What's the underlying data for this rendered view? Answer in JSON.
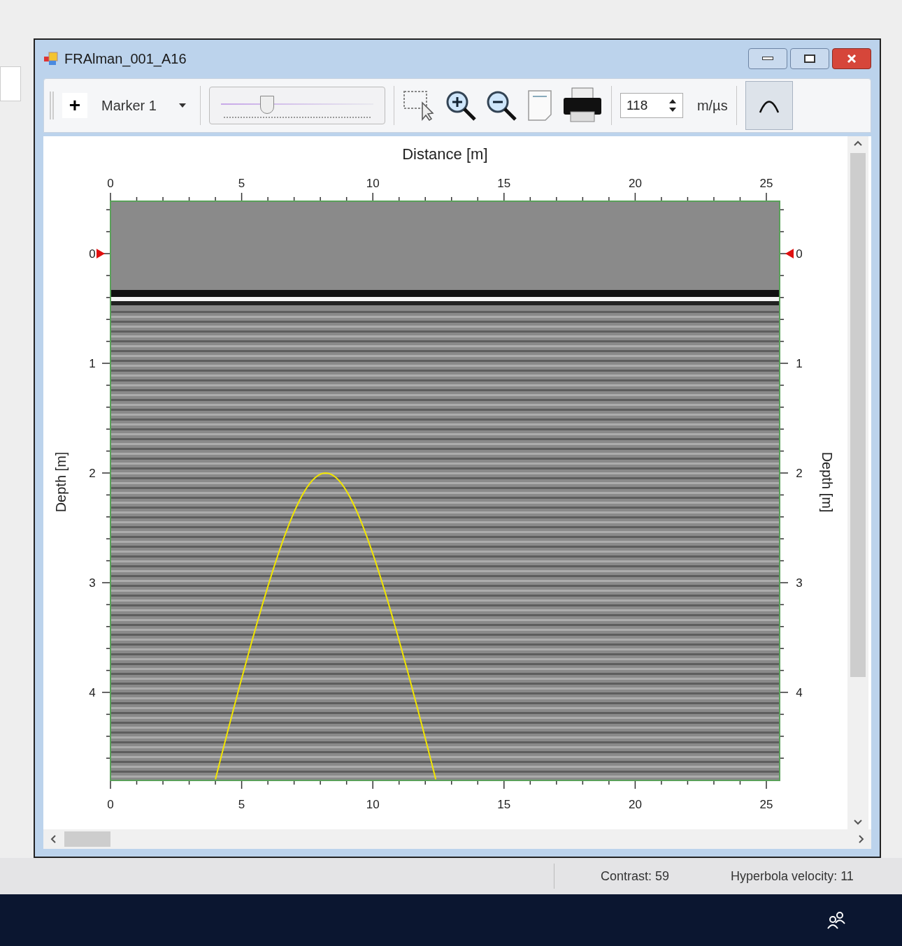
{
  "window": {
    "title": "FRAlman_001_A16"
  },
  "toolbar": {
    "add_button": "+",
    "marker_dropdown": {
      "value": "Marker 1"
    },
    "slider": {
      "level": 0.28
    },
    "velocity": {
      "value": "118",
      "unit": "m/µs"
    },
    "hyperbola_button": {
      "pressed": true
    }
  },
  "plot": {
    "x_title": "Distance [m]",
    "top_ticks": [
      "0",
      "5",
      "10",
      "15",
      "20",
      "25"
    ],
    "bottom_ticks": [
      "0",
      "5",
      "10",
      "15",
      "20",
      "25"
    ],
    "left_title": "Depth [m]",
    "right_title": "Depth [m]",
    "left_ticks": [
      "0",
      "1",
      "2",
      "3",
      "4"
    ],
    "right_ticks": [
      "0",
      "1",
      "2",
      "3",
      "4"
    ],
    "hyperbola": {
      "shown": true
    }
  },
  "status_bar": {
    "contrast": "Contrast: 59",
    "hyperbola_velocity": "Hyperbola velocity: 11"
  }
}
